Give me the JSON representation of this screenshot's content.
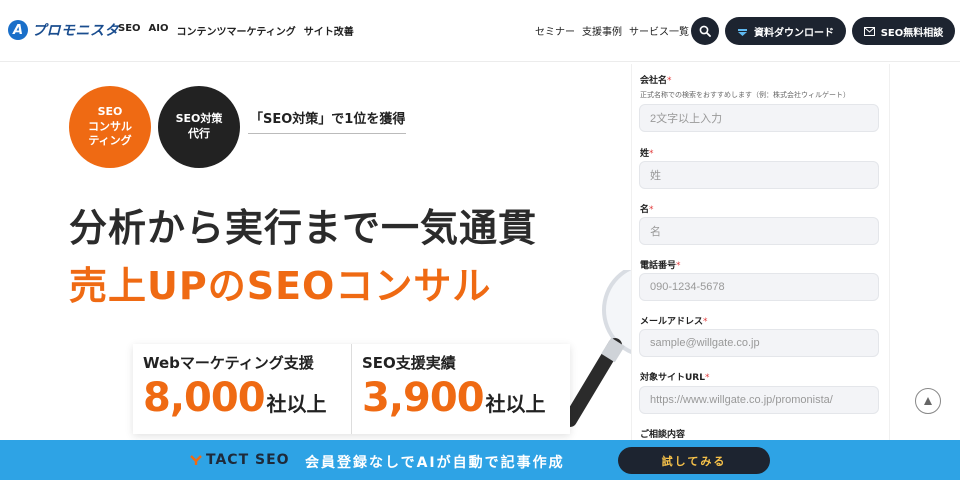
{
  "header": {
    "logo_text": "プロモニスタ",
    "nav_left": [
      "SEO",
      "AIO",
      "コンテンツマーケティング",
      "サイト改善"
    ],
    "nav_right": [
      "セミナー",
      "支援事例",
      "サービス一覧"
    ],
    "download_label": "資料ダウンロード",
    "consult_label": "SEO無料相談"
  },
  "hero": {
    "badge_orange": "SEO\nコンサル\nティング",
    "badge_black": "SEO対策\n代行",
    "tagline": "「SEO対策」で1位を獲得",
    "headline1": "分析から実行まで一気通貫",
    "headline2": "売上UPのSEOコンサル"
  },
  "stats": [
    {
      "label": "Webマーケティング支援",
      "value": "8,000",
      "unit": "社以上"
    },
    {
      "label": "SEO支援実績",
      "value": "3,900",
      "unit": "社以上"
    }
  ],
  "form": {
    "company": {
      "label": "会社名",
      "required": "*",
      "note": "正式名称での検索をおすすめします（例：株式会社ウィルゲート）",
      "placeholder": "2文字以上入力"
    },
    "last_name": {
      "label": "姓",
      "required": "*",
      "placeholder": "姓"
    },
    "first_name": {
      "label": "名",
      "required": "*",
      "placeholder": "名"
    },
    "phone": {
      "label": "電話番号",
      "required": "*",
      "placeholder": "090-1234-5678"
    },
    "email": {
      "label": "メールアドレス",
      "required": "*",
      "placeholder": "sample@willgate.co.jp"
    },
    "site_url": {
      "label": "対象サイトURL",
      "required": "*",
      "placeholder": "https://www.willgate.co.jp/promonista/"
    },
    "inquiry": {
      "label": "ご相談内容"
    }
  },
  "banner": {
    "logo_text": "TACT SEO",
    "text": "会員登録なしでAIが自動で記事作成",
    "button_label": "試してみる"
  },
  "colors": {
    "accent_orange": "#ef6a13",
    "dark": "#1d2430",
    "banner_blue": "#2ea3e5",
    "brand_blue": "#1a6fc9"
  }
}
